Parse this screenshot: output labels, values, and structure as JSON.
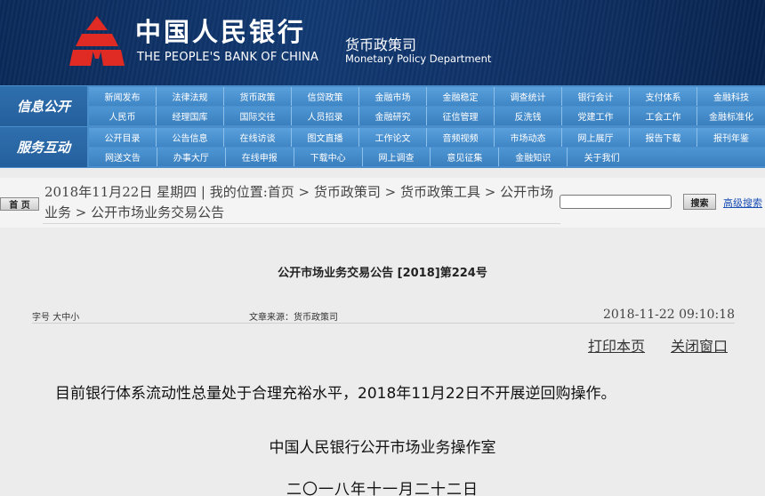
{
  "header": {
    "bank_name_cn": "中国人民银行",
    "bank_name_en": "THE PEOPLE'S BANK OF CHINA",
    "dept_cn": "货币政策司",
    "dept_en": "Monetary Policy Department",
    "logo_color": "#e02a24"
  },
  "nav": {
    "info_title": "信息公开",
    "info_row1": [
      "新闻发布",
      "法律法规",
      "货币政策",
      "信贷政策",
      "金融市场",
      "金融稳定",
      "调查统计",
      "银行会计",
      "支付体系",
      "金融科技"
    ],
    "info_row2": [
      "人民币",
      "经理国库",
      "国际交往",
      "人员招录",
      "金融研究",
      "征信管理",
      "反洗钱",
      "党建工作",
      "工会工作",
      "金融标准化"
    ],
    "service_title": "服务互动",
    "service_row1": [
      "公开目录",
      "公告信息",
      "在线访谈",
      "图文直播",
      "工作论文",
      "音频视频",
      "市场动态",
      "网上展厅",
      "报告下载",
      "报刊年鉴"
    ],
    "service_row2": [
      "网送文告",
      "办事大厅",
      "在线申报",
      "下载中心",
      "网上调查",
      "意见征集",
      "金融知识",
      "关于我们"
    ]
  },
  "crumb": {
    "home_label": "首 页",
    "text": "2018年11月22日 星期四 | 我的位置:首页 > 货币政策司 > 货币政策工具 > 公开市场业务 > 公开市场业务交易公告",
    "search_placeholder": "",
    "search_button": "搜索",
    "advanced_search": "高级搜索"
  },
  "article": {
    "title": "公开市场业务交易公告 [2018]第224号",
    "font_size_label": "字号",
    "font_large": "大",
    "font_medium": "中",
    "font_small": "小",
    "source": "文章来源：货币政策司",
    "datetime": "2018-11-22 09:10:18",
    "print_label": "打印本页",
    "close_label": "关闭窗口",
    "body": "目前银行体系流动性总量处于合理充裕水平，2018年11月22日不开展逆回购操作。",
    "signature_org": "中国人民银行公开市场业务操作室",
    "signature_date": "二〇一八年十一月二十二日"
  }
}
